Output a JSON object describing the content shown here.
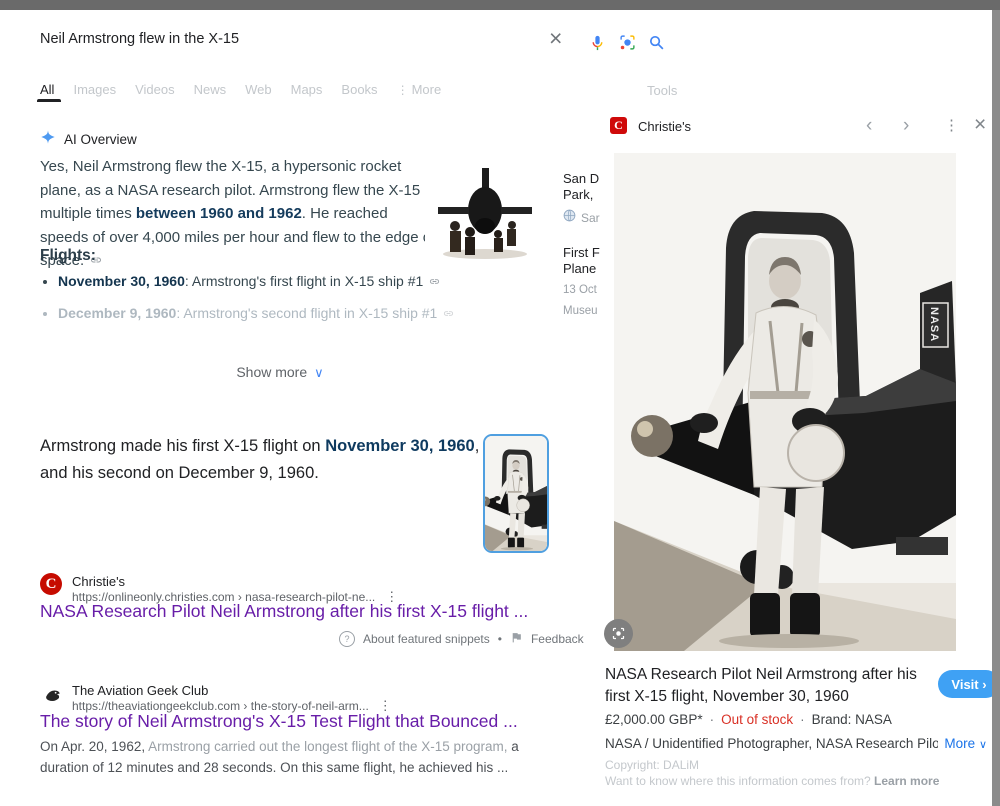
{
  "search": {
    "query": "Neil Armstrong flew in the X-15"
  },
  "tabs": {
    "items": [
      "All",
      "Images",
      "Videos",
      "News",
      "Web",
      "Maps",
      "Books"
    ],
    "more": "More",
    "tools": "Tools"
  },
  "icons": {
    "close": "×",
    "more_vertical": "⋮",
    "chevron_left": "‹",
    "chevron_right": "›",
    "chevron_down": "∨",
    "help": "?",
    "bullet": "•"
  },
  "ai": {
    "label": "AI Overview",
    "p1": "Yes, Neil Armstrong flew the X-15, a hypersonic rocket plane, as a NASA research pilot. Armstrong flew the X-15 multiple times ",
    "hl": "between 1960 and 1962",
    "p2": ". He reached speeds of over 4,000 miles per hour and flew to the edge of space.",
    "flights_heading": "Flights:",
    "flight1_date": "November 30, 1960",
    "flight1_desc": ": Armstrong's first flight in X-15 ship #1",
    "flight2_date": "December 9, 1960",
    "flight2_desc": ": Armstrong's second flight in X-15 ship #1",
    "show_more": "Show more",
    "cit1_line1": "San D",
    "cit1_line2": "Park,",
    "cit1_src": "Sar",
    "cit2_line1": "First F",
    "cit2_line2": "Plane",
    "cit2_date": "13 Oct",
    "cit2_src": "Museu"
  },
  "featured": {
    "p1": "Armstrong made his first X-15 flight on ",
    "hl": "November 30, 1960",
    "p2": ", and his second on December 9, 1960."
  },
  "result1": {
    "logo_letter": "C",
    "site": "Christie's",
    "url": "https://onlineonly.christies.com › nasa-research-pilot-ne...",
    "title": "NASA Research Pilot Neil Armstrong after his first X-15 flight ..."
  },
  "snippet_footer": {
    "about": "About featured snippets",
    "dot": "•",
    "feedback": "Feedback"
  },
  "result2": {
    "site": "The Aviation Geek Club",
    "url": "https://theaviationgeekclub.com › the-story-of-neil-arm...",
    "title": "The story of Neil Armstrong's X-15 Test Flight that Bounced ...",
    "s1": "On Apr. 20, 1962, ",
    "s2": "Armstrong carried out the longest flight of the X-15 program,",
    "s3": " a duration of 12 minutes and 28 seconds. On this same flight, he achieved his ..."
  },
  "panel": {
    "logo_letter": "C",
    "source": "Christie's",
    "tail_text": "NASA",
    "title": "NASA Research Pilot Neil Armstrong after his first X-15 flight, November 30, 1960",
    "visit": "Visit ›",
    "price": "£2,000.00 GBP*",
    "dot": "·",
    "stock": "Out of stock",
    "brand": "Brand: NASA",
    "attribution": "NASA / Unidentified Photographer, NASA Research Pilot Neil Armstrong…",
    "more": "More",
    "copyright": "Copyright: DALiM",
    "info": "Want to know where this information comes from?",
    "learn_more": "Learn more"
  },
  "colors": {
    "accent_blue": "#4285f4",
    "link_blue": "#1a73e8",
    "visited_purple": "#681da8",
    "stock_red": "#d93025",
    "visit_button_blue": "#3fa1f4",
    "christies_red": "#c60b00"
  }
}
